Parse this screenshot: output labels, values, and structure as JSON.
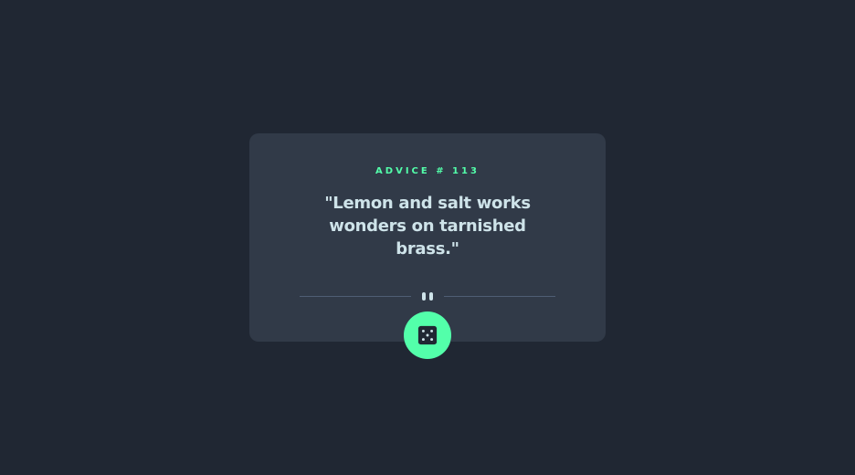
{
  "advice": {
    "id_label": "ADVICE # 113",
    "quote": "\"Lemon and salt works wonders on tarnished brass.\""
  },
  "divider": {
    "icon": "pause-icon"
  },
  "dice_button": {
    "icon": "dice-icon"
  },
  "colors": {
    "background": "#202733",
    "card": "#313a48",
    "accent": "#53ffaa",
    "text": "#cee3e9",
    "divider": "#4f5d74"
  }
}
